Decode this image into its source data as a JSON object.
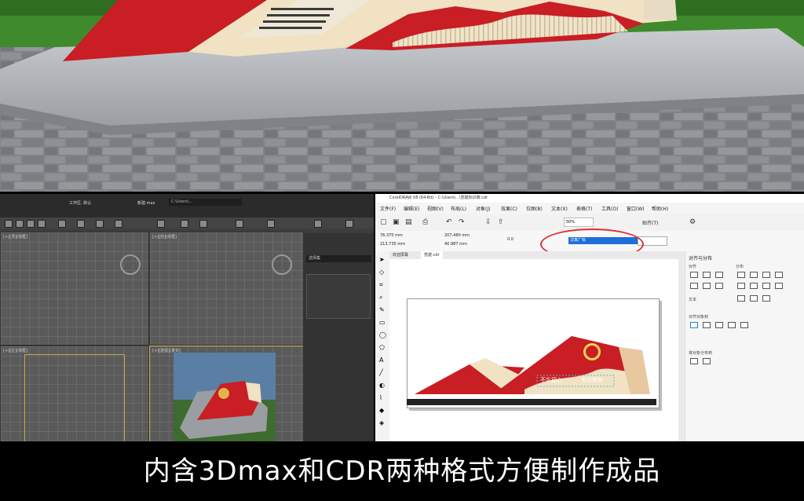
{
  "max_window": {
    "file_label": "新建.max",
    "workspace_label": "工作区: 默认",
    "path_text": "C:\\Users\\...",
    "command_panel_label": "选择集",
    "viewport_labels": [
      "[+][顶][线框]",
      "[+][前][线框]",
      "[+][左][线框]",
      "[+][透视][真实]"
    ]
  },
  "cdr_window": {
    "title": "CorelDRAW X8 (64-Bit) - C:\\Users\\...\\党建标识牌.cdr",
    "menu": [
      "文件(F)",
      "编辑(E)",
      "视图(V)",
      "布局(L)",
      "对象(J)",
      "效果(C)",
      "位图(B)",
      "文本(X)",
      "表格(T)",
      "工具(O)",
      "窗口(W)",
      "帮助(H)"
    ],
    "zoom": "50%",
    "snap_label": "贴齐(T)",
    "x_field": "76.370 mm",
    "y_field": "213.735 mm",
    "w_field": "207.480 mm",
    "h_field": "40.987 mm",
    "angle": "0.0",
    "font_name": "汉真广标",
    "tabs": [
      "欢迎屏幕",
      "党建.cdr"
    ],
    "dock_title": "对齐与分布",
    "dock_align": "对齐",
    "dock_distribute": "分布",
    "dock_text": "文本",
    "dock_objspacing": "对齐对象到",
    "dock_spacing": "将对象分布到",
    "sign_text_left": "不忘初心",
    "sign_text_right": "牢记使命",
    "sign_subtext": "DON'T FORGET THE ORIGINAL INTENTION, REMEMBER THE MISSION"
  },
  "caption": "内含3Dmax和CDR两种格式方便制作成品",
  "colors": {
    "sign_red": "#c81e24",
    "sign_cream": "#f1e2c3",
    "selection_ellipse": "#e03030"
  }
}
